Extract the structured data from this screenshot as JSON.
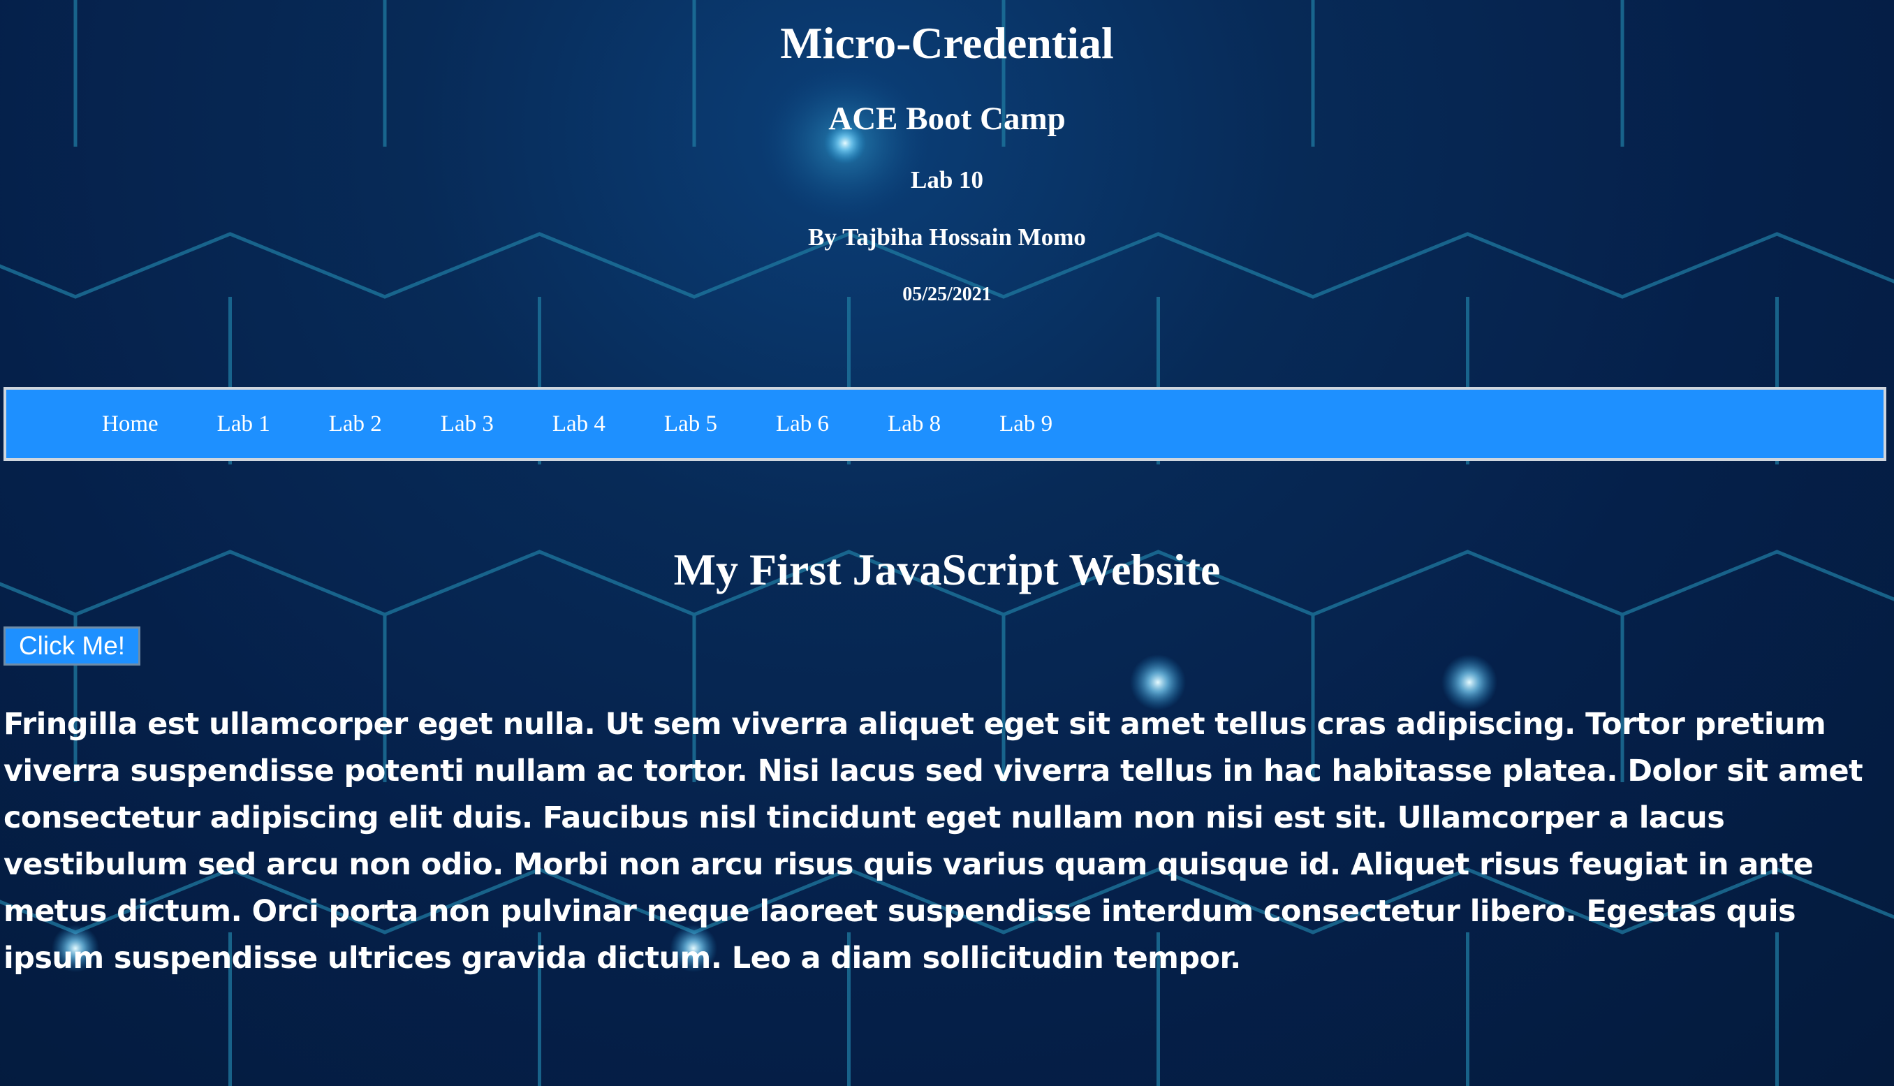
{
  "header": {
    "title": "Micro-Credential",
    "subtitle": "ACE Boot Camp",
    "lab": "Lab 10",
    "author": "By Tajbiha Hossain Momo",
    "date": "05/25/2021"
  },
  "nav": {
    "items": [
      {
        "label": "Home"
      },
      {
        "label": "Lab 1"
      },
      {
        "label": "Lab 2"
      },
      {
        "label": "Lab 3"
      },
      {
        "label": "Lab 4"
      },
      {
        "label": "Lab 5"
      },
      {
        "label": "Lab 6"
      },
      {
        "label": "Lab 8"
      },
      {
        "label": "Lab 9"
      }
    ],
    "background": "#1e90ff"
  },
  "main": {
    "heading": "My First JavaScript Website",
    "button_label": "Click Me!",
    "paragraph": "Fringilla est ullamcorper eget nulla. Ut sem viverra aliquet eget sit amet tellus cras adipiscing. Tortor pretium viverra suspendisse potenti nullam ac tortor. Nisi lacus sed viverra tellus in hac habitasse platea. Dolor sit amet consectetur adipiscing elit duis. Faucibus nisl tincidunt eget nullam non nisi est sit. Ullamcorper a lacus vestibulum sed arcu non odio. Morbi non arcu risus quis varius quam quisque id. Aliquet risus feugiat in ante metus dictum. Orci porta non pulvinar neque laoreet suspendisse interdum consectetur libero. Egestas quis ipsum suspendisse ultrices gravida dictum. Leo a diam sollicitudin tempor."
  },
  "colors": {
    "background": "#05204a",
    "hex_lines": "#1f6f9a",
    "accent": "#1e90ff"
  }
}
